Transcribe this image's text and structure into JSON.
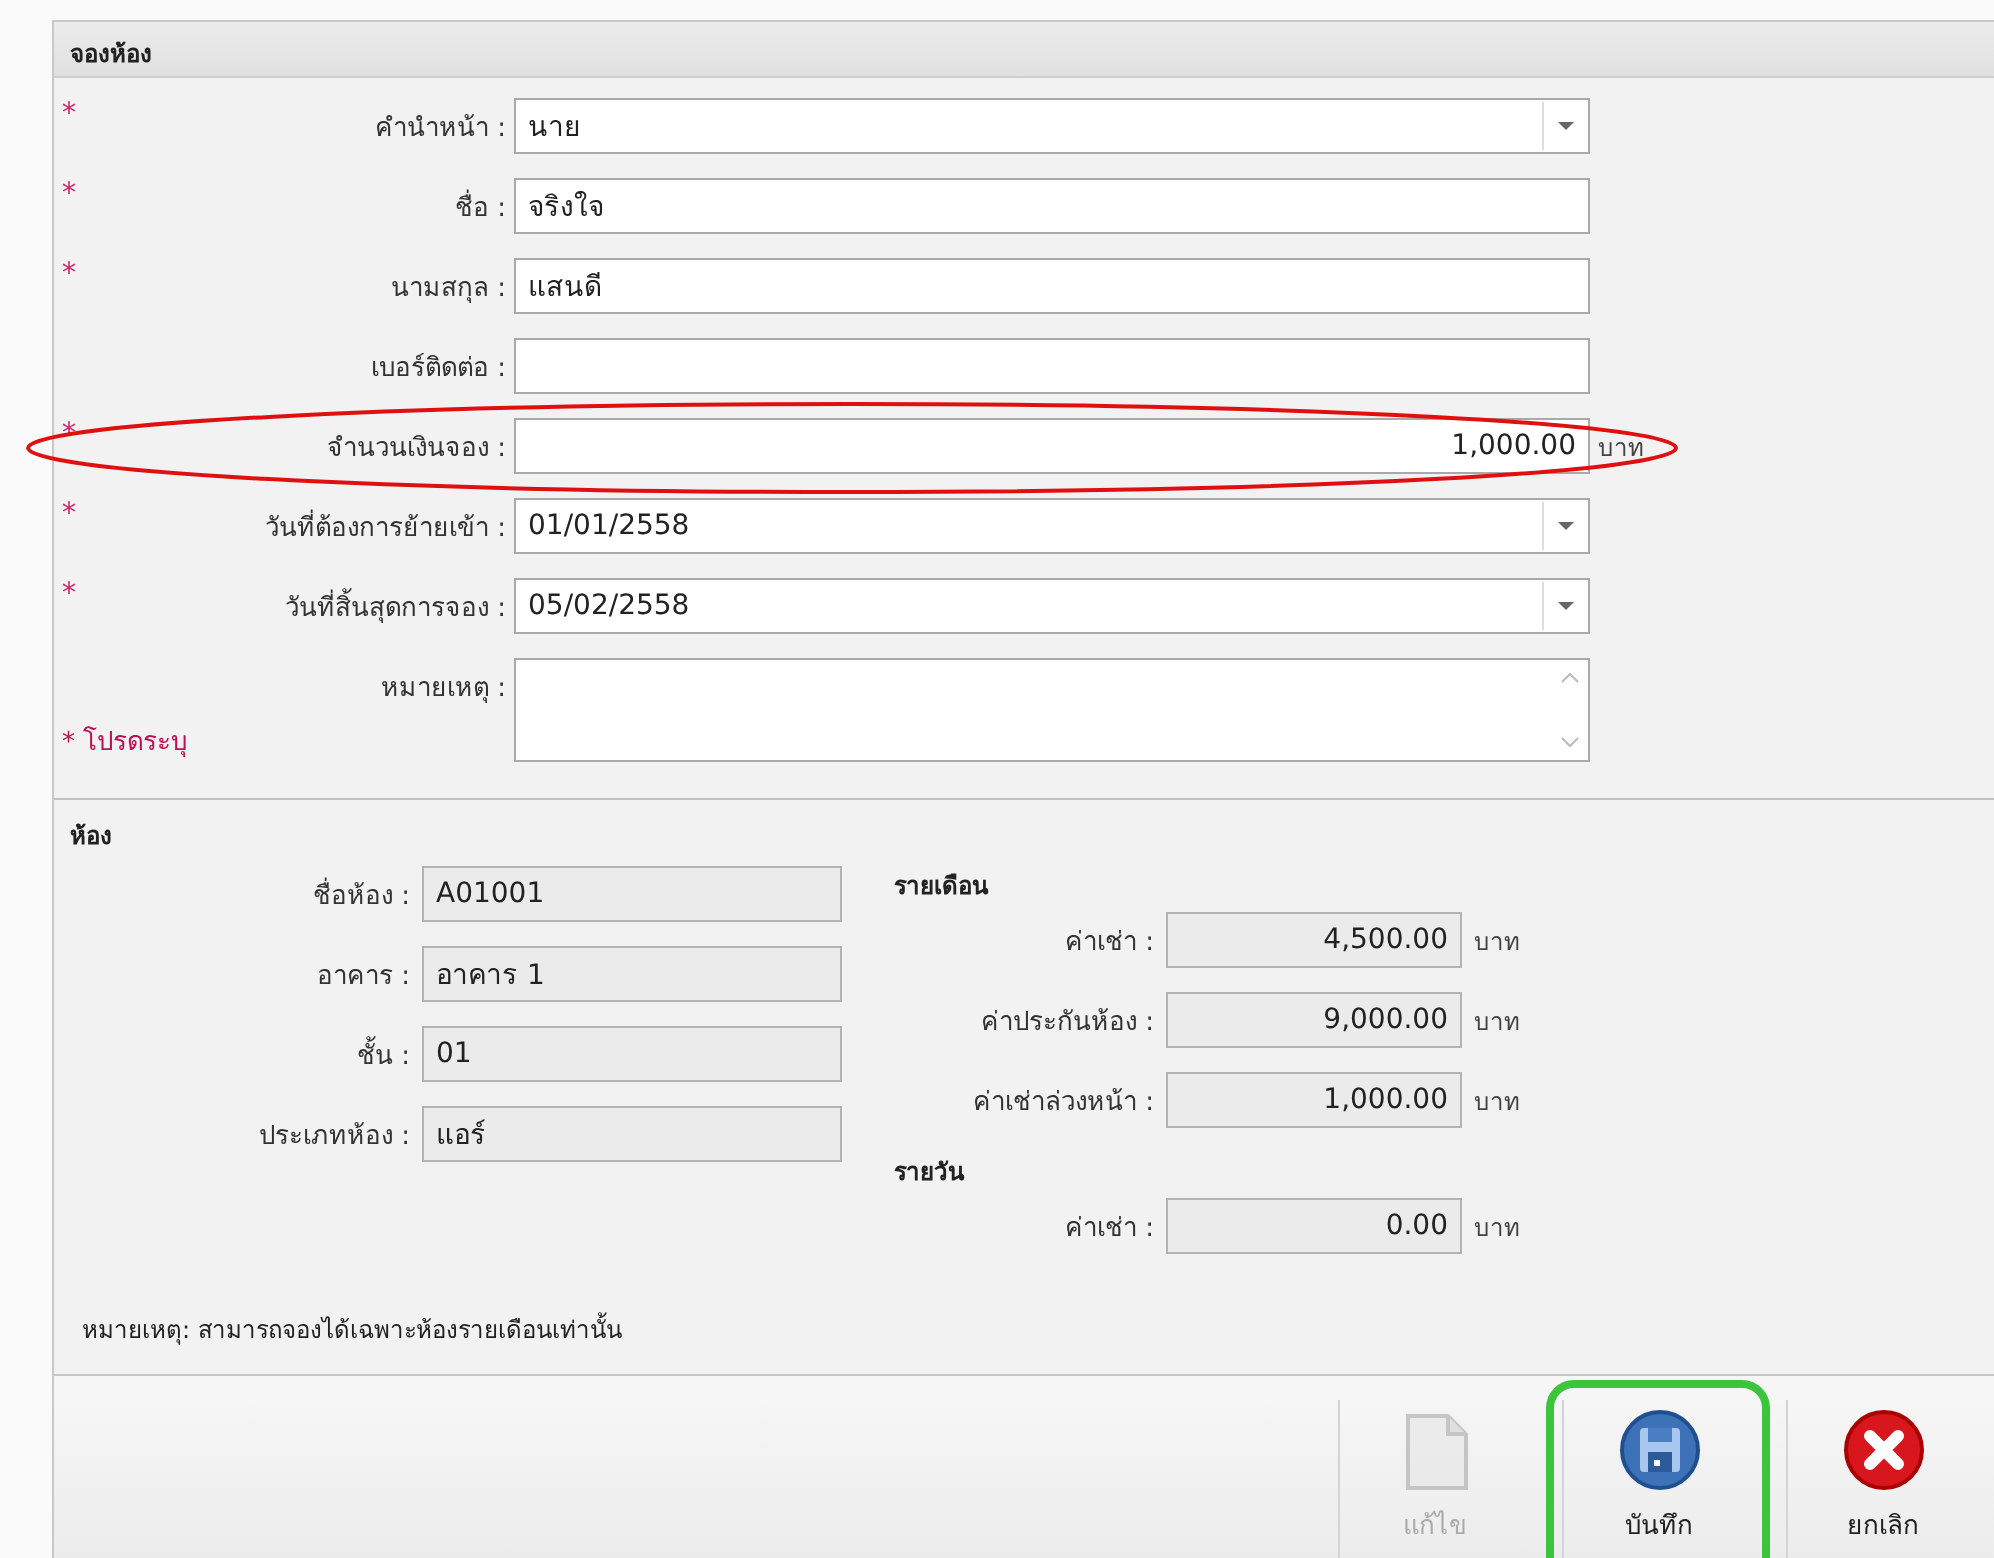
{
  "booking": {
    "title": "จองห้อง",
    "required_mark": "*",
    "required_note": "* โปรดระบุ",
    "fields": [
      {
        "kind": "dropdown",
        "label": "คำนำหน้า :",
        "value": "นาย",
        "required": true,
        "highlighted": false
      },
      {
        "kind": "text",
        "label": "ชื่อ :",
        "value": "จริงใจ",
        "required": true,
        "highlighted": false
      },
      {
        "kind": "text",
        "label": "นามสกุล :",
        "value": "แสนดี",
        "required": true,
        "highlighted": false
      },
      {
        "kind": "text",
        "label": "เบอร์ติดต่อ :",
        "required": false,
        "highlighted": false
      },
      {
        "kind": "amount",
        "label": "จำนวนเงินจอง :",
        "value": "1,000.00",
        "unit": "บาท",
        "required": true,
        "highlighted": true
      },
      {
        "kind": "dropdown",
        "label": "วันที่ต้องการย้ายเข้า :",
        "value": "01/01/2558",
        "required": true,
        "highlighted": false
      },
      {
        "kind": "dropdown",
        "label": "วันที่สิ้นสุดการจอง :",
        "value": "05/02/2558",
        "required": true,
        "highlighted": false
      },
      {
        "kind": "memo",
        "label": "หมายเหตุ :",
        "required": false,
        "highlighted": false
      }
    ]
  },
  "room": {
    "title": "ห้อง",
    "fields": [
      {
        "label": "ชื่อห้อง :",
        "value": "A01001"
      },
      {
        "label": "อาคาร :",
        "value": "อาคาร 1"
      },
      {
        "label": "ชั้น :",
        "value": "01"
      },
      {
        "label": "ประเภทห้อง :",
        "value": "แอร์"
      }
    ],
    "rates": [
      {
        "title": "รายเดือน",
        "fields": [
          {
            "label": "ค่าเช่า :",
            "value": "4,500.00",
            "unit": "บาท"
          },
          {
            "label": "ค่าประกันห้อง :",
            "value": "9,000.00",
            "unit": "บาท"
          },
          {
            "label": "ค่าเช่าล่วงหน้า :",
            "value": "1,000.00",
            "unit": "บาท"
          }
        ]
      },
      {
        "title": "รายวัน",
        "fields": [
          {
            "label": "ค่าเช่า :",
            "value": "0.00",
            "unit": "บาท"
          }
        ]
      }
    ],
    "note": "หมายเหตุ: สามารถจองได้เฉพาะห้องรายเดือนเท่านั้น"
  },
  "toolbar": [
    {
      "kind": "edit",
      "label": "แก้ไข",
      "disabled": true,
      "highlighted": false
    },
    {
      "kind": "save",
      "label": "บันทึก",
      "disabled": false,
      "highlighted": true
    },
    {
      "kind": "cancel",
      "label": "ยกเลิก",
      "disabled": false,
      "highlighted": false
    }
  ]
}
